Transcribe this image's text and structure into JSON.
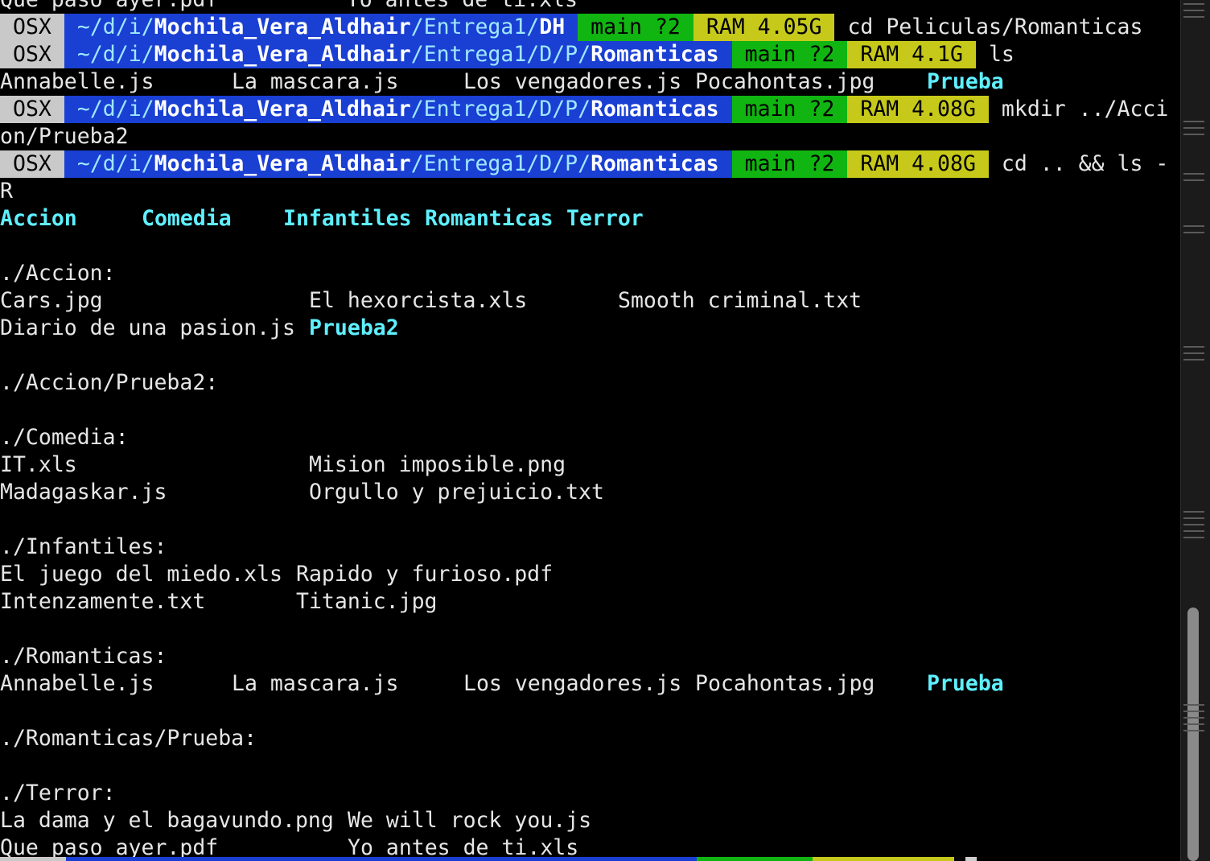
{
  "colors": {
    "os_bg": "#c9c9c9",
    "path_bg": "#1a3fd3",
    "branch_bg": "#11b511",
    "ram_bg": "#c7c91a",
    "dir_text": "#5ef0ff"
  },
  "partial_top_line": "Que paso ayer.pdf          Yo antes de ti.xls",
  "prompts": [
    {
      "os": "OSX",
      "path_prefix": "~/d/i/",
      "path_bold": "Mochila_Vera_Aldhair",
      "path_mid": "/Entrega1/",
      "path_end": "DH",
      "branch": "main ?2",
      "ram": "RAM 4.05G",
      "command": "cd Peliculas/Romanticas"
    },
    {
      "os": "OSX",
      "path_prefix": "~/d/i/",
      "path_bold": "Mochila_Vera_Aldhair",
      "path_mid": "/Entrega1/D/P/",
      "path_end": "Romanticas",
      "branch": "main ?2",
      "ram": "RAM 4.1G",
      "command": "ls"
    },
    {
      "os": "OSX",
      "path_prefix": "~/d/i/",
      "path_bold": "Mochila_Vera_Aldhair",
      "path_mid": "/Entrega1/D/P/",
      "path_end": "Romanticas",
      "branch": "main ?2",
      "ram": "RAM 4.08G",
      "command": "mkdir ../Acci",
      "command_wrap": "on/Prueba2"
    },
    {
      "os": "OSX",
      "path_prefix": "~/d/i/",
      "path_bold": "Mochila_Vera_Aldhair",
      "path_mid": "/Entrega1/D/P/",
      "path_end": "Romanticas",
      "branch": "main ?2",
      "ram": "RAM 4.08G",
      "command": "cd .. && ls -",
      "command_wrap": "R"
    }
  ],
  "ls_romanticas": {
    "files": [
      "Annabelle.js",
      "La mascara.js",
      "Los vengadores.js",
      "Pocahontas.jpg"
    ],
    "dir": "Prueba"
  },
  "ls_root_dirs": [
    "Accion",
    "Comedia",
    "Infantiles",
    "Romanticas",
    "Terror"
  ],
  "sections": {
    "accion": {
      "header": "./Accion:",
      "row1": [
        "Cars.jpg",
        "El hexorcista.xls",
        "Smooth criminal.txt"
      ],
      "row2_file": "Diario de una pasion.js",
      "row2_dir": "Prueba2"
    },
    "accion_prueba2": {
      "header": "./Accion/Prueba2:"
    },
    "comedia": {
      "header": "./Comedia:",
      "row1": [
        "IT.xls",
        "Mision imposible.png"
      ],
      "row2": [
        "Madagaskar.js",
        "Orgullo y prejuicio.txt"
      ]
    },
    "infantiles": {
      "header": "./Infantiles:",
      "row1": [
        "El juego del miedo.xls",
        "Rapido y furioso.pdf"
      ],
      "row2": [
        "Intenzamente.txt",
        "Titanic.jpg"
      ]
    },
    "romanticas": {
      "header": "./Romanticas:",
      "files": [
        "Annabelle.js",
        "La mascara.js",
        "Los vengadores.js",
        "Pocahontas.jpg"
      ],
      "dir": "Prueba"
    },
    "romanticas_prueba": {
      "header": "./Romanticas/Prueba:"
    },
    "terror": {
      "header": "./Terror:",
      "row1": [
        "La dama y el bagavundo.png",
        "We will rock you.js"
      ],
      "row2": [
        "Que paso ayer.pdf",
        "Yo antes de ti.xls"
      ]
    }
  }
}
